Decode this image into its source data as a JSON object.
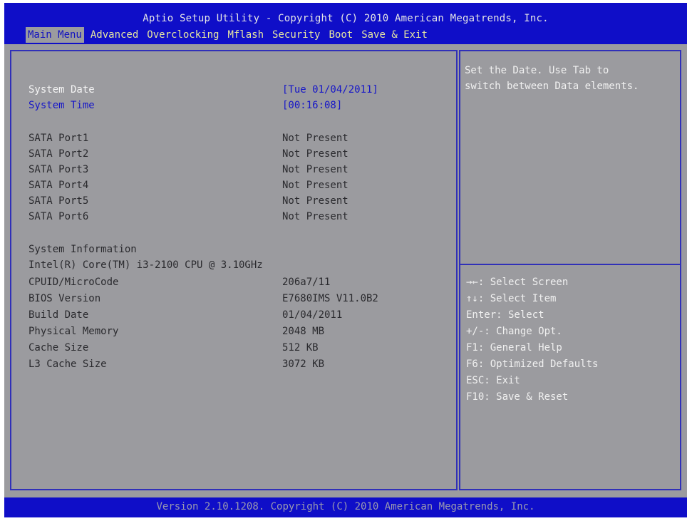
{
  "title": "Aptio Setup Utility - Copyright (C) 2010 American Megatrends, Inc.",
  "tabs": [
    {
      "label": "Main Menu"
    },
    {
      "label": "Advanced"
    },
    {
      "label": "Overclocking"
    },
    {
      "label": "Mflash"
    },
    {
      "label": "Security"
    },
    {
      "label": "Boot"
    },
    {
      "label": "Save & Exit"
    }
  ],
  "main": {
    "system_date": {
      "label": "System Date",
      "value": "[Tue 01/04/2011]"
    },
    "system_time": {
      "label": "System Time",
      "value": "[00:16:08]"
    },
    "sata_ports": [
      {
        "label": "SATA Port1",
        "value": "Not Present"
      },
      {
        "label": "SATA Port2",
        "value": "Not Present"
      },
      {
        "label": "SATA Port3",
        "value": "Not Present"
      },
      {
        "label": "SATA Port4",
        "value": "Not Present"
      },
      {
        "label": "SATA Port5",
        "value": "Not Present"
      },
      {
        "label": "SATA Port6",
        "value": "Not Present"
      }
    ],
    "system_information": {
      "heading": "System Information",
      "cpu": "Intel(R) Core(TM) i3-2100 CPU @ 3.10GHz",
      "items": [
        {
          "label": "CPUID/MicroCode",
          "value": "206a7/11"
        },
        {
          "label": "BIOS Version",
          "value": "E7680IMS V11.0B2"
        },
        {
          "label": "Build Date",
          "value": "01/04/2011"
        },
        {
          "label": "Physical Memory",
          "value": "2048 MB"
        },
        {
          "label": "Cache Size",
          "value": "512 KB"
        },
        {
          "label": "L3 Cache Size",
          "value": "3072 KB"
        }
      ]
    }
  },
  "help": {
    "description_lines": [
      "Set the Date. Use Tab to",
      "switch between Data elements."
    ],
    "keys": [
      "→←: Select Screen",
      "↑↓: Select Item",
      "Enter: Select",
      "+/-: Change Opt.",
      "F1: General Help",
      "F6: Optimized Defaults",
      "ESC: Exit",
      "F10: Save & Reset"
    ]
  },
  "footer": "Version 2.10.1208. Copyright (C) 2010 American Megatrends, Inc."
}
